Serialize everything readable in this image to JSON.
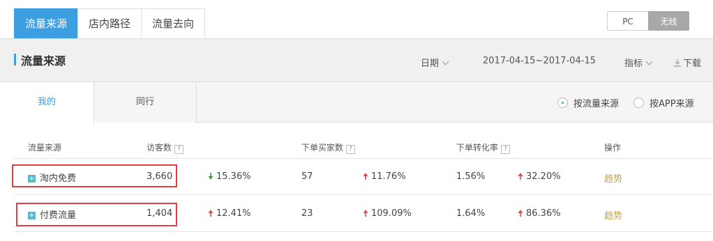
{
  "top_tabs": [
    "流量来源",
    "店内路径",
    "流量去向"
  ],
  "device": {
    "pc": "PC",
    "wireless": "无线"
  },
  "header": {
    "title": "流量来源",
    "date_label": "日期",
    "date_range": "2017-04-15~2017-04-15",
    "metric_label": "指标",
    "download": "下载"
  },
  "sub_tabs": {
    "mine": "我的",
    "peer": "同行"
  },
  "radios": {
    "by_source": "按流量来源",
    "by_app": "按APP来源"
  },
  "columns": {
    "source": "流量来源",
    "visitors": "访客数",
    "buyers": "下单买家数",
    "conversion": "下单转化率",
    "action": "操作"
  },
  "rows": [
    {
      "name": "淘内免费",
      "visitors": "3,660",
      "visitors_change": "15.36%",
      "visitors_dir": "down",
      "buyers": "57",
      "buyers_change": "11.76%",
      "buyers_dir": "up",
      "conv": "1.56%",
      "conv_change": "32.20%",
      "conv_dir": "up",
      "action": "趋势"
    },
    {
      "name": "付费流量",
      "visitors": "1,404",
      "visitors_change": "12.41%",
      "visitors_dir": "up",
      "buyers": "23",
      "buyers_change": "109.09%",
      "buyers_dir": "up",
      "conv": "1.64%",
      "conv_change": "86.36%",
      "conv_dir": "up",
      "action": "趋势"
    }
  ],
  "colors": {
    "accent": "#3d9ee0",
    "up": "#e24a4a",
    "down": "#3aa33a",
    "highlight_box": "#e24040"
  }
}
